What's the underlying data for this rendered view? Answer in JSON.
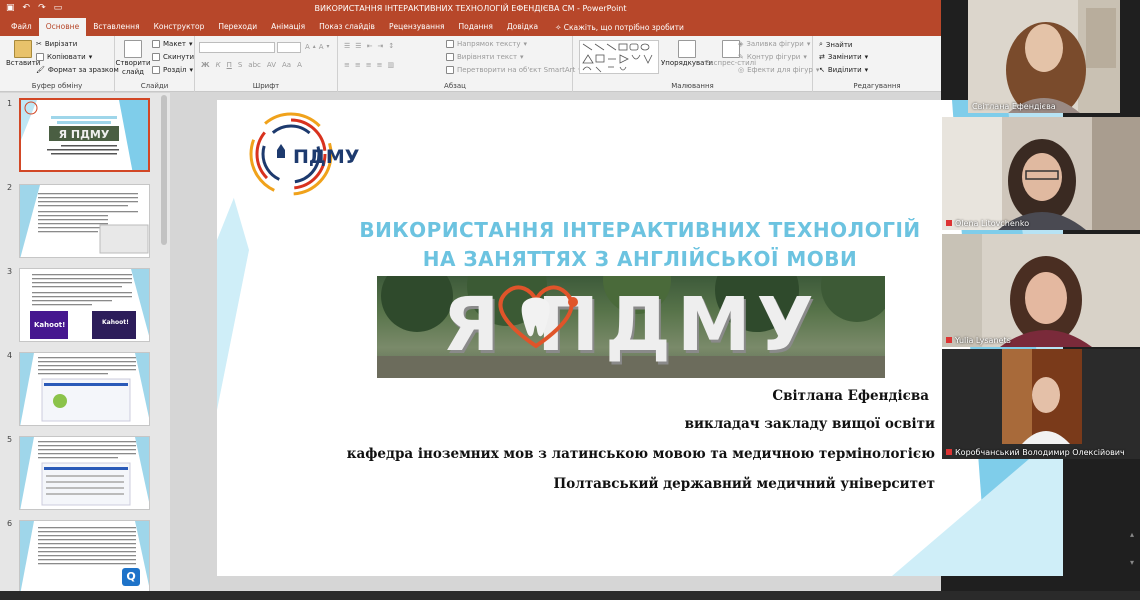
{
  "window": {
    "title": "ВИКОРИСТАННЯ ІНТЕРАКТИВНИХ ТЕХНОЛОГІЙ ЕФЕНДІЄВА СМ  -  PowerPoint"
  },
  "tabs": [
    "Файл",
    "Основне",
    "Вставлення",
    "Конструктор",
    "Переходи",
    "Анімація",
    "Показ слайдів",
    "Рецензування",
    "Подання",
    "Довідка"
  ],
  "active_tab": "Основне",
  "tell_me": "Скажіть, що потрібно зробити",
  "ribbon": {
    "clipboard": {
      "paste": "Вставити",
      "cut": "Вирізати",
      "copy": "Копіювати",
      "format_painter": "Формат за зразком",
      "label": "Буфер обміну"
    },
    "slides": {
      "new_slide": "Створити слайд",
      "layout": "Макет",
      "reset": "Скинути",
      "section": "Розділ",
      "label": "Слайди"
    },
    "font": {
      "label": "Шрифт"
    },
    "paragraph": {
      "text_direction": "Напрямок тексту",
      "align_text": "Вирівняти текст",
      "smartart": "Перетворити на об'єкт SmartArt",
      "label": "Абзац"
    },
    "drawing": {
      "arrange": "Упорядкувати",
      "quick_styles": "Експрес-стилі",
      "fill": "Заливка фігури",
      "outline": "Контур фігури",
      "effects": "Ефекти для фігур",
      "label": "Малювання"
    },
    "editing": {
      "find": "Знайти",
      "replace": "Замінити",
      "select": "Виділити",
      "label": "Редагування"
    }
  },
  "thumbnails": [
    {
      "num": "1"
    },
    {
      "num": "2"
    },
    {
      "num": "3",
      "kahoot": "Kahoot!"
    },
    {
      "num": "4"
    },
    {
      "num": "5"
    },
    {
      "num": "6"
    }
  ],
  "slide": {
    "logo_text": "ПДМУ",
    "title_line1": "ВИКОРИСТАННЯ ІНТЕРАКТИВНИХ ТЕХНОЛОГІЙ",
    "title_line2": "НА ЗАНЯТТЯХ З АНГЛІЙСЬКОЇ МОВИ",
    "banner_text": "Я  ПДМУ",
    "author": "Світлана Ефендієва",
    "position": "викладач закладу вищої освіти",
    "department": "кафедра іноземних мов з латинською мовою та медичною термінологією",
    "university": "Полтавський державний медичний університет"
  },
  "participants": [
    {
      "name": "Світлана Ефендієва"
    },
    {
      "name": "Olena Litovchenko"
    },
    {
      "name": "Yulia Lysanets"
    },
    {
      "name": "Коробчанський Володимир Олексійович"
    }
  ],
  "colors": {
    "accent": "#b7472a",
    "title_blue": "#6cc3e0",
    "triangle_blue": "#7fcdea"
  }
}
